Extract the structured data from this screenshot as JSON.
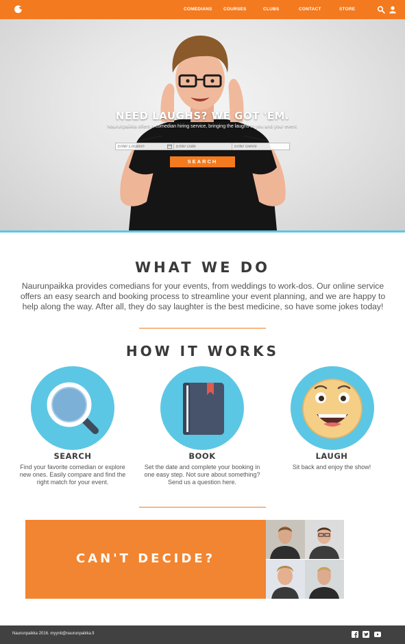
{
  "nav": {
    "links": [
      "COMEDIANS",
      "COURSES",
      "CLUBS",
      "CONTACT",
      "STORE"
    ],
    "icons": [
      "search-icon",
      "user-icon"
    ],
    "brand_color": "#f47a1f"
  },
  "hero": {
    "title": "NEED LAUGHS? WE GOT 'EM.",
    "subtitle": "Naurunpaikka offers a comedian hiring service, bringing the laughs to you and your event.",
    "location_placeholder": "Enter Location",
    "date_placeholder": "Enter Date",
    "genre_placeholder": "Enter Genre",
    "search_label": "SEARCH",
    "accent_line_color": "#5bc7e4"
  },
  "what_we_do": {
    "title": "WHAT WE DO",
    "text": "Naurunpaikka provides comedians for your events, from weddings to work-dos. Our online service offers an easy search and booking process to streamline your event planning, and we are happy to help along the way. After all, they do say laughter is the best medicine, so have some jokes today!"
  },
  "how_it_works": {
    "title": "HOW IT WORKS",
    "steps": [
      {
        "title": "SEARCH",
        "icon": "magnifier-icon",
        "text": "Find your favorite comedian or explore new ones. Easily compare and find the right match for your event."
      },
      {
        "title": "BOOK",
        "icon": "book-icon",
        "text": "Set the date and complete your booking in one easy step. Not sure about something? Send us a question here."
      },
      {
        "title": "LAUGH",
        "icon": "smiley-icon",
        "text": "Sit back and enjoy the show!"
      }
    ]
  },
  "cta": {
    "text": "CAN'T DECIDE?"
  },
  "footer": {
    "text": "Naurunpaikka 2016. myynti@naurunpaikka.fi",
    "social_icons": [
      "facebook-icon",
      "twitter-icon",
      "youtube-icon"
    ]
  }
}
